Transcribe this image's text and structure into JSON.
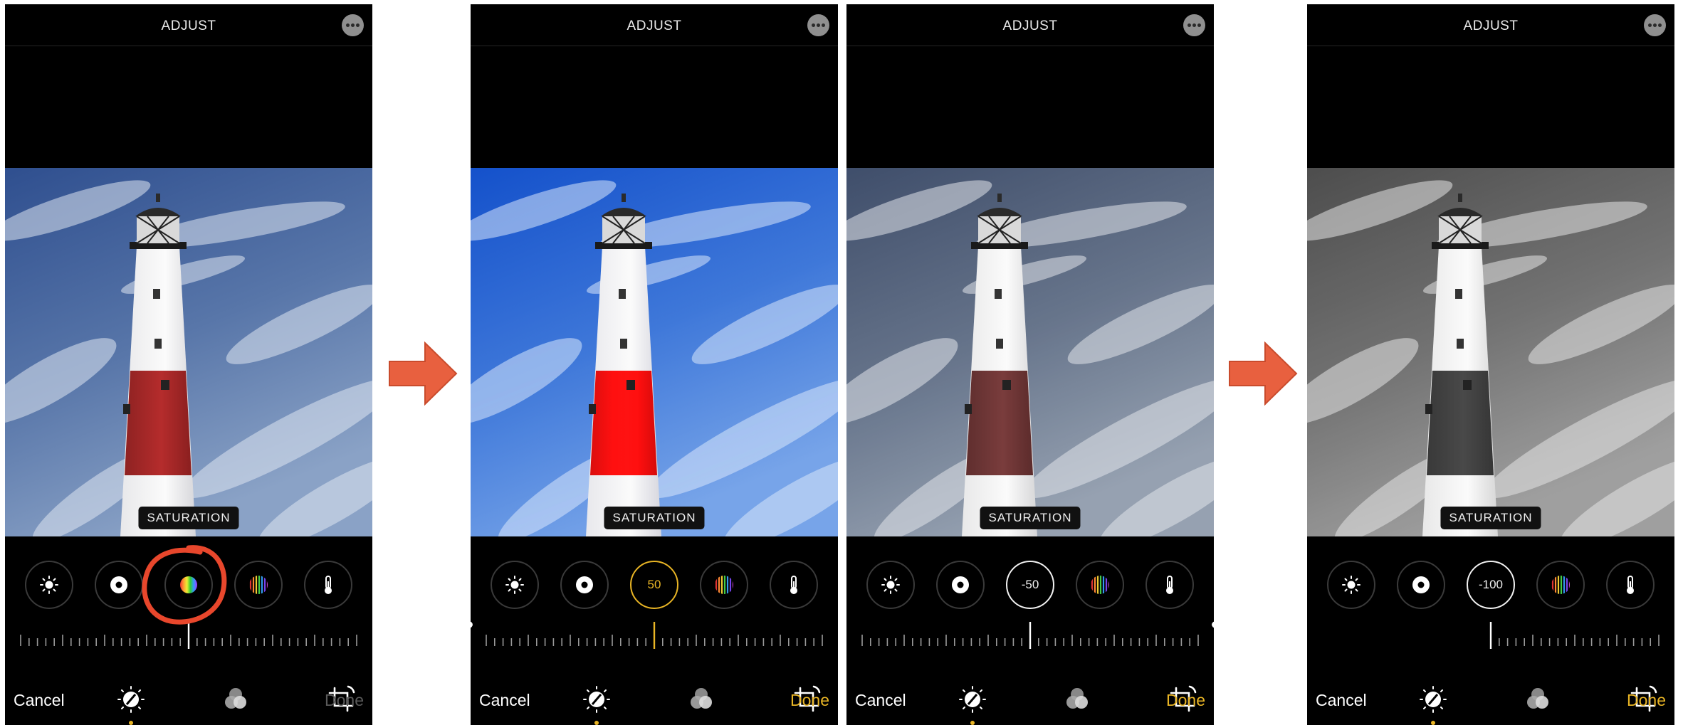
{
  "colors": {
    "accent": "#e9b525",
    "annotation": "#e8472c",
    "arrow_fill": "#e8603f",
    "done_disabled": "#5a5a5a"
  },
  "panels": [
    {
      "title": "ADJUST",
      "label": "SATURATION",
      "active_value": "",
      "active_style": "plain",
      "cancel": "Cancel",
      "done": "Done",
      "done_enabled": false,
      "saturation": 0,
      "filter": "none"
    },
    {
      "title": "ADJUST",
      "label": "SATURATION",
      "active_value": "50",
      "active_style": "yellow",
      "cancel": "Cancel",
      "done": "Done",
      "done_enabled": true,
      "saturation": 50,
      "filter": "saturate(1.9)"
    },
    {
      "title": "ADJUST",
      "label": "SATURATION",
      "active_value": "-50",
      "active_style": "white",
      "cancel": "Cancel",
      "done": "Done",
      "done_enabled": true,
      "saturation": -50,
      "filter": "saturate(0.45)"
    },
    {
      "title": "ADJUST",
      "label": "SATURATION",
      "active_value": "-100",
      "active_style": "white",
      "cancel": "Cancel",
      "done": "Done",
      "done_enabled": true,
      "saturation": -100,
      "filter": "grayscale(1)"
    }
  ],
  "tool_icons": [
    "sun-icon",
    "vignette-icon",
    "saturation-icon",
    "vibrance-icon",
    "thermometer-icon"
  ],
  "bottom_tabs": [
    "adjust-icon",
    "filters-icon",
    "crop-icon"
  ],
  "annotations": {
    "arrows": 2,
    "circle_on": "saturation-tool-panel-1"
  }
}
